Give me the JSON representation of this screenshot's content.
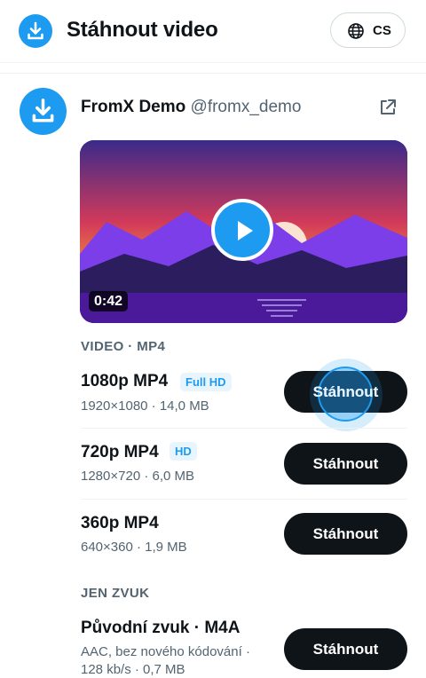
{
  "header": {
    "title": "Stáhnout video",
    "language": "CS",
    "logo_icon": "download-icon",
    "language_icon": "globe-icon"
  },
  "post": {
    "author_name": "FromX Demo",
    "author_handle": "@fromx_demo",
    "avatar_icon": "download-icon",
    "open_icon": "external-link-icon"
  },
  "video": {
    "duration": "0:42",
    "play_icon": "play-icon"
  },
  "sections": {
    "video_label": "VIDEO · MP4",
    "audio_label": "JEN ZVUK"
  },
  "formats": [
    {
      "name": "1080p MP4",
      "badge": "Full HD",
      "meta": "1920×1080 · 14,0 MB",
      "button": "Stáhnout"
    },
    {
      "name": "720p MP4",
      "badge": "HD",
      "meta": "1280×720 · 6,0 MB",
      "button": "Stáhnout"
    },
    {
      "name": "360p MP4",
      "badge": "",
      "meta": "640×360 · 1,9 MB",
      "button": "Stáhnout"
    },
    {
      "name": "Původní zvuk · M4A",
      "badge": "",
      "meta": "AAC, bez nového kódování ·",
      "meta2": "128 kb/s · 0,7 MB",
      "button": "Stáhnout"
    }
  ],
  "colors": {
    "accent": "#1d9bf0",
    "button": "#0f1419"
  }
}
